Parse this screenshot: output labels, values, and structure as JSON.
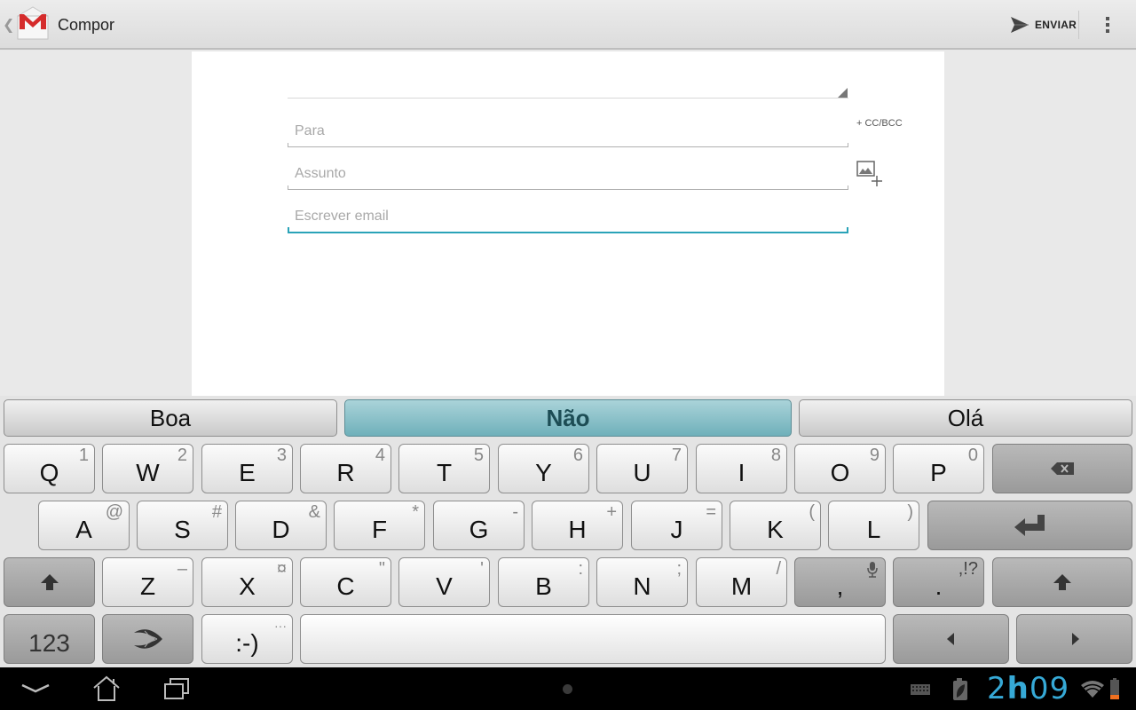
{
  "action_bar": {
    "title": "Compor",
    "send_label": "ENVIAR",
    "icons": {
      "up": "up-caret-icon",
      "app": "gmail-icon",
      "send": "send-icon",
      "overflow": "overflow-menu-icon"
    }
  },
  "compose": {
    "to_placeholder": "Para",
    "to_value": "",
    "subject_placeholder": "Assunto",
    "subject_value": "",
    "body_placeholder": "Escrever email",
    "body_value": "",
    "cc_bcc_label": "+ CC/BCC",
    "attach_icon": "attach-picture-icon",
    "focused_field": "body",
    "accent_color": "#2aa3b8"
  },
  "keyboard": {
    "suggestions": [
      {
        "label": "Boa",
        "active": false
      },
      {
        "label": "Não",
        "active": true
      },
      {
        "label": "Olá",
        "active": false
      }
    ],
    "rows": [
      [
        {
          "main": "Q",
          "alt": "1"
        },
        {
          "main": "W",
          "alt": "2"
        },
        {
          "main": "E",
          "alt": "3"
        },
        {
          "main": "R",
          "alt": "4"
        },
        {
          "main": "T",
          "alt": "5"
        },
        {
          "main": "Y",
          "alt": "6"
        },
        {
          "main": "U",
          "alt": "7"
        },
        {
          "main": "I",
          "alt": "8"
        },
        {
          "main": "O",
          "alt": "9"
        },
        {
          "main": "P",
          "alt": "0"
        },
        {
          "main": "",
          "alt": "",
          "icon": "backspace-icon"
        }
      ],
      [
        {
          "main": "A",
          "alt": "@"
        },
        {
          "main": "S",
          "alt": "#"
        },
        {
          "main": "D",
          "alt": "&"
        },
        {
          "main": "F",
          "alt": "*"
        },
        {
          "main": "G",
          "alt": "-"
        },
        {
          "main": "H",
          "alt": "+"
        },
        {
          "main": "J",
          "alt": "="
        },
        {
          "main": "K",
          "alt": "("
        },
        {
          "main": "L",
          "alt": ")"
        },
        {
          "main": "",
          "alt": "",
          "icon": "enter-icon"
        }
      ],
      [
        {
          "main": "",
          "alt": "",
          "icon": "shift-icon"
        },
        {
          "main": "Z",
          "alt": "–"
        },
        {
          "main": "X",
          "alt": "¤"
        },
        {
          "main": "C",
          "alt": "\""
        },
        {
          "main": "V",
          "alt": "'"
        },
        {
          "main": "B",
          "alt": ":"
        },
        {
          "main": "N",
          "alt": ";"
        },
        {
          "main": "M",
          "alt": "/"
        },
        {
          "main": ",",
          "alt": "",
          "icon": "microphone-icon"
        },
        {
          "main": ".",
          "alt": ",!?"
        },
        {
          "main": "",
          "alt": "",
          "icon": "shift-icon"
        }
      ],
      [
        {
          "main": "123",
          "alt": ""
        },
        {
          "main": "",
          "alt": "",
          "icon": "swiftkey-logo-icon"
        },
        {
          "main": ":-)",
          "alt": "···"
        },
        {
          "main": "",
          "alt": "",
          "icon": "space-bar"
        },
        {
          "main": "",
          "alt": "",
          "icon": "cursor-left-icon"
        },
        {
          "main": "",
          "alt": "",
          "icon": "cursor-right-icon"
        }
      ]
    ]
  },
  "navbar": {
    "icons": [
      "back-icon",
      "home-icon",
      "recent-apps-icon"
    ],
    "clock_hour": "2",
    "clock_h": "h",
    "clock_min": "09",
    "status_icons": [
      "keyboard-icon",
      "battery-saver-icon",
      "wifi-icon",
      "battery-low-icon"
    ],
    "battery_color": "#f07020"
  }
}
